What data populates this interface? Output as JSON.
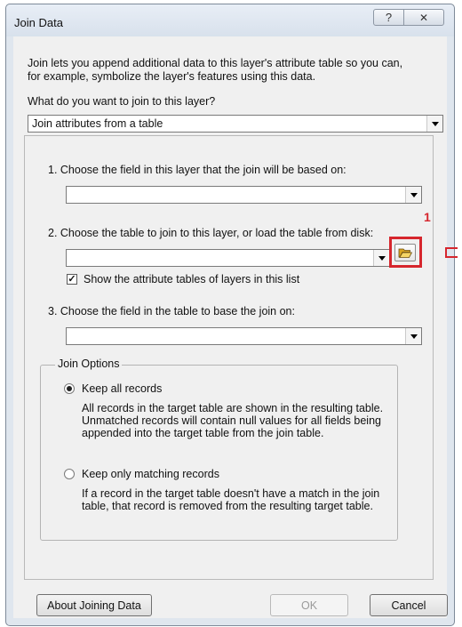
{
  "window": {
    "title": "Join Data",
    "help_glyph": "?",
    "close_glyph": "✕"
  },
  "intro": "Join lets you append additional data to this layer's attribute table so you can,|for example, symbolize the layer's features using this data.",
  "question": "What do you want to join to this layer?",
  "join_type": {
    "selected": "Join attributes from a table"
  },
  "step1": {
    "label": "1.  Choose the field in this layer that the join will be based on:",
    "value": ""
  },
  "step2": {
    "label": "2.  Choose the table to join to this layer, or load the table from disk:",
    "value": "",
    "checkbox_label": "Show the attribute tables of layers in this list",
    "checkbox_checked": true,
    "open_icon": "open-folder-icon"
  },
  "step3": {
    "label": "3.  Choose the field in the table to base the join on:",
    "value": ""
  },
  "join_options": {
    "legend": "Join Options",
    "keep_all": {
      "label": "Keep all records",
      "selected": true,
      "desc": [
        "All records in the target table are shown in the resulting table.",
        "Unmatched records will contain null values for all fields being",
        "appended into the target table from the join table."
      ]
    },
    "keep_matching": {
      "label": "Keep only matching records",
      "selected": false,
      "desc": [
        "If a record in the target table doesn't have a match in the join",
        "table, that record is removed from the resulting target table."
      ]
    }
  },
  "buttons": {
    "about": "About Joining Data",
    "ok": "OK",
    "cancel": "Cancel"
  },
  "annotation": {
    "number": "1",
    "color": "#d6262d"
  }
}
